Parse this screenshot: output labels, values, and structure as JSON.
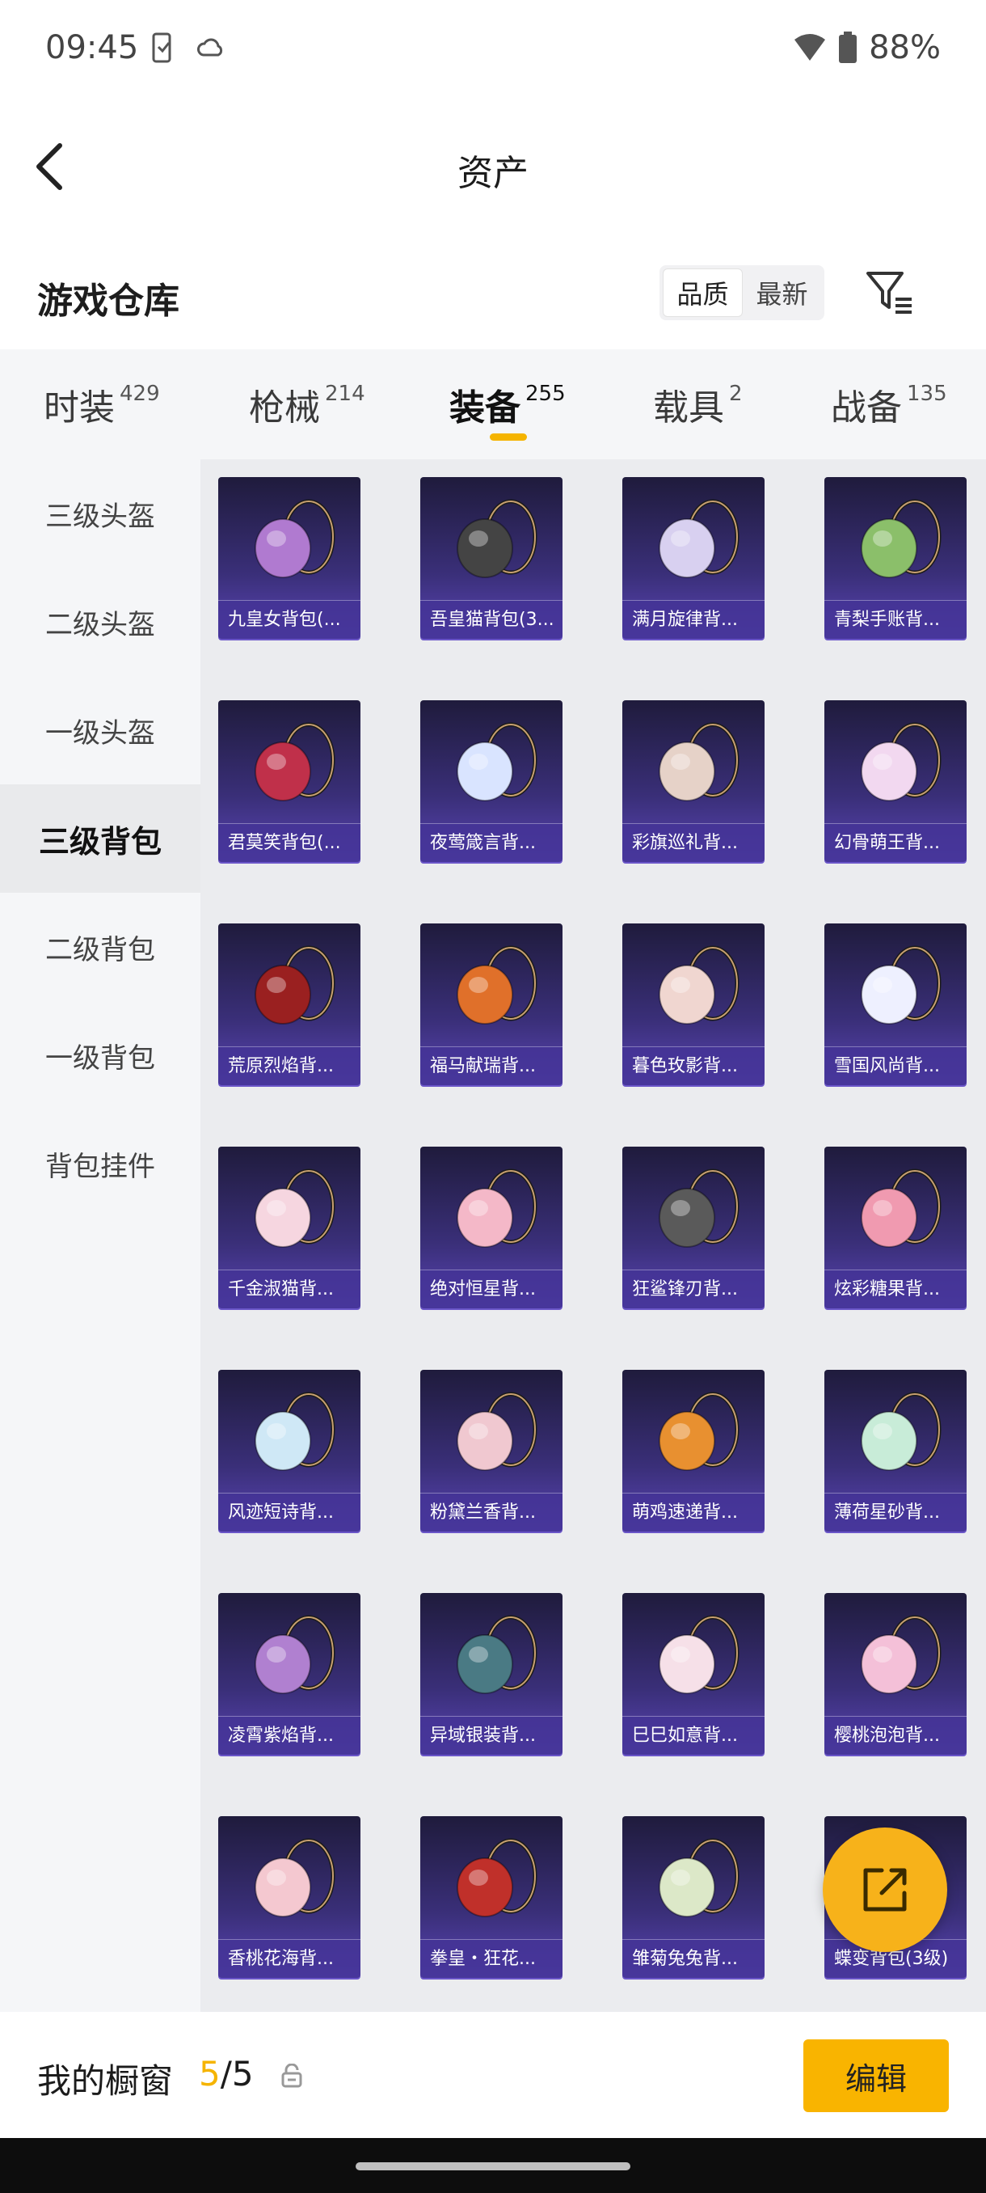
{
  "status": {
    "time": "09:45",
    "battery": "88%"
  },
  "header": {
    "title": "资产"
  },
  "warehouse": {
    "title": "游戏仓库",
    "sort_options": [
      "品质",
      "最新"
    ],
    "active_sort": "品质"
  },
  "tabs": [
    {
      "label": "时装",
      "count": "429"
    },
    {
      "label": "枪械",
      "count": "214"
    },
    {
      "label": "装备",
      "count": "255"
    },
    {
      "label": "载具",
      "count": "2"
    },
    {
      "label": "战备",
      "count": "135"
    }
  ],
  "active_tab": "装备",
  "sidebar": {
    "items": [
      "三级头盔",
      "二级头盔",
      "一级头盔",
      "三级背包",
      "二级背包",
      "一级背包",
      "背包挂件"
    ],
    "active": "三级背包"
  },
  "items": [
    {
      "name": "九皇女背包(...",
      "icon": "backpack-charm-icon",
      "color": "#b07ad0"
    },
    {
      "name": "吾皇猫背包(3...",
      "icon": "cat-backpack-icon",
      "color": "#444444"
    },
    {
      "name": "满月旋律背...",
      "icon": "moon-backpack-icon",
      "color": "#d8d0f0"
    },
    {
      "name": "青梨手账背...",
      "icon": "pear-backpack-icon",
      "color": "#8bbf6a"
    },
    {
      "name": "君莫笑背包(...",
      "icon": "winged-backpack-icon",
      "color": "#c0304a"
    },
    {
      "name": "夜莺箴言背...",
      "icon": "flower-backpack-icon",
      "color": "#d9e4ff"
    },
    {
      "name": "彩旗巡礼背...",
      "icon": "shield-backpack-icon",
      "color": "#e6d2c8"
    },
    {
      "name": "幻骨萌王背...",
      "icon": "creature-backpack-icon",
      "color": "#f2d8f0"
    },
    {
      "name": "荒原烈焰背...",
      "icon": "flame-backpack-icon",
      "color": "#9a2020"
    },
    {
      "name": "福马献瑞背...",
      "icon": "horse-backpack-icon",
      "color": "#e0702a"
    },
    {
      "name": "暮色玫影背...",
      "icon": "doll-backpack-icon",
      "color": "#f0d6d0"
    },
    {
      "name": "雪国风尚背...",
      "icon": "penguin-backpack-icon",
      "color": "#eef0ff"
    },
    {
      "name": "千金淑猫背...",
      "icon": "bow-backpack-icon",
      "color": "#f6d6e0"
    },
    {
      "name": "绝对恒星背...",
      "icon": "popcorn-backpack-icon",
      "color": "#f4b8c8"
    },
    {
      "name": "狂鲨锋刃背...",
      "icon": "shark-backpack-icon",
      "color": "#5a5a5a"
    },
    {
      "name": "炫彩糖果背...",
      "icon": "candy-backpack-icon",
      "color": "#f09ab0"
    },
    {
      "name": "风迹短诗背...",
      "icon": "box-backpack-icon",
      "color": "#cfe8f6"
    },
    {
      "name": "粉黛兰香背...",
      "icon": "orchid-backpack-icon",
      "color": "#f0c8d0"
    },
    {
      "name": "萌鸡速递背...",
      "icon": "chick-backpack-icon",
      "color": "#e89030"
    },
    {
      "name": "薄荷星砂背...",
      "icon": "mint-backpack-icon",
      "color": "#c8ecd8"
    },
    {
      "name": "凌霄紫焰背...",
      "icon": "purple-flame-backpack-icon",
      "color": "#b080d0"
    },
    {
      "name": "异域银装背...",
      "icon": "tactical-backpack-icon",
      "color": "#4a7a84"
    },
    {
      "name": "巳巳如意背...",
      "icon": "snake-backpack-icon",
      "color": "#f6e0e8"
    },
    {
      "name": "樱桃泡泡背...",
      "icon": "ribbon-backpack-icon",
      "color": "#f4c0d8"
    },
    {
      "name": "香桃花海背...",
      "icon": "peach-backpack-icon",
      "color": "#f4c8d0"
    },
    {
      "name": "拳皇・狂花...",
      "icon": "fighter-backpack-icon",
      "color": "#c0302a"
    },
    {
      "name": "雏菊兔兔背...",
      "icon": "bunny-backpack-icon",
      "color": "#dce8c8"
    },
    {
      "name": "蝶变背包(3级)",
      "icon": "butterfly-backpack-icon",
      "color": "#e0e0e0"
    }
  ],
  "showcase": {
    "label": "我的橱窗",
    "current": "5",
    "separator": "/",
    "total": "5"
  },
  "edit_button": "编辑",
  "colors": {
    "accent": "#f5b400",
    "card_bg": "#3a2f79"
  }
}
